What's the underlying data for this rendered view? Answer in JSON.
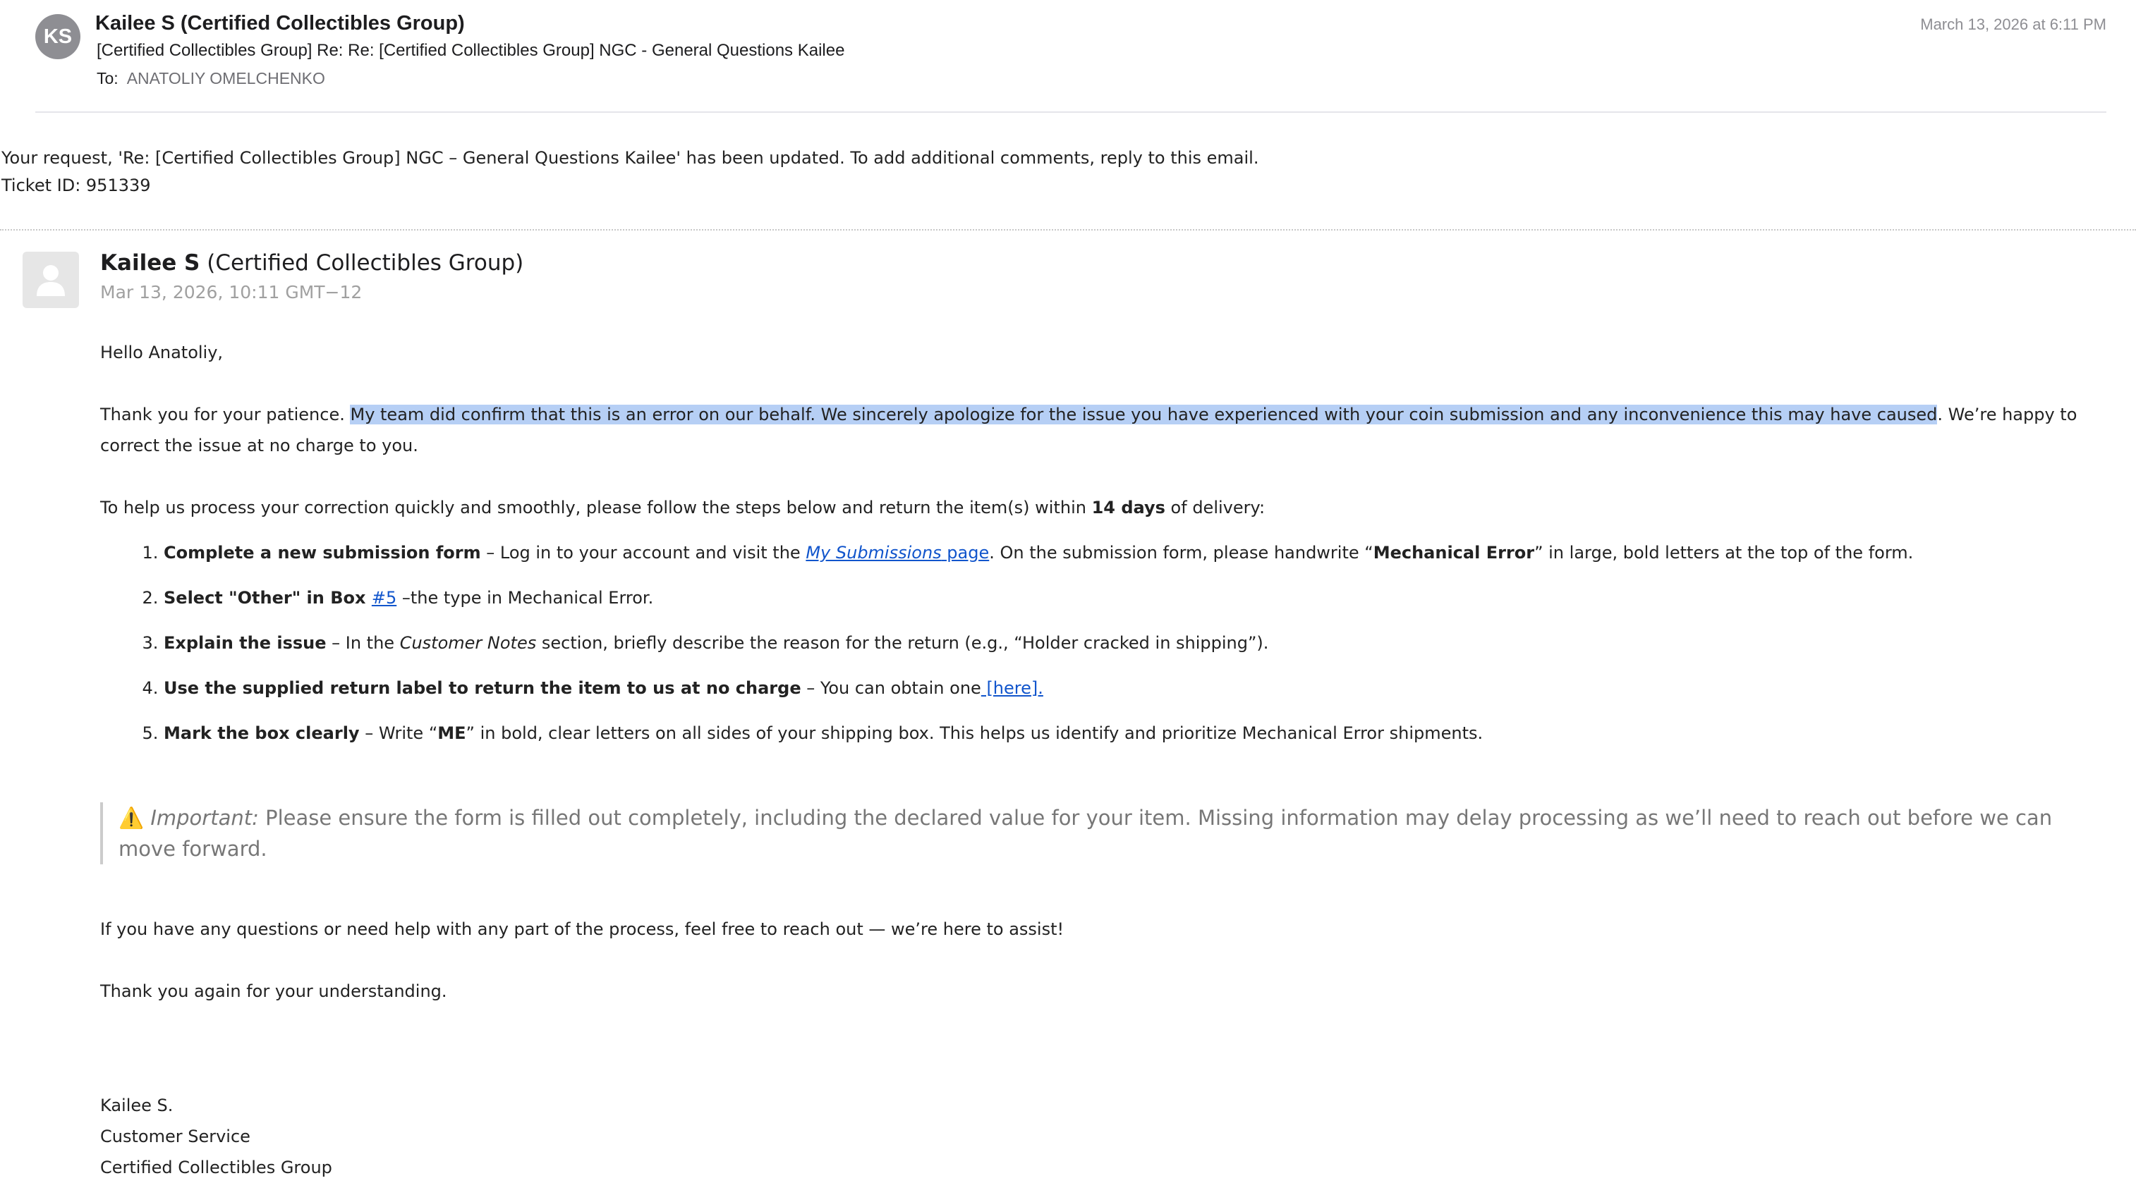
{
  "header": {
    "avatar_initials": "KS",
    "sender": "Kailee S (Certified Collectibles Group)",
    "subject": "[Certified Collectibles Group] Re: Re: [Certified Collectibles Group] NGC - General Questions Kailee",
    "to_label": "To:",
    "to_name": "ANATOLIY OMELCHENKO",
    "date": "March 13, 2026 at 6:11 PM"
  },
  "notice": {
    "line1": "Your request, 'Re: [Certified Collectibles Group] NGC – General Questions Kailee' has been updated. To add additional comments, reply to this email.",
    "line2": "Ticket ID: 951339"
  },
  "comment": {
    "author_name": "Kailee S",
    "author_org": "(Certified Collectibles Group)",
    "timestamp": "Mar 13, 2026, 10:11 GMT−12"
  },
  "message": {
    "greeting": "Hello Anatoliy,",
    "para1_start": "Thank you for your patience. ",
    "para1_highlight": "My team did confirm that this is an error on our behalf. We sincerely apologize for the issue you have experienced with your coin submission and any inconvenience this may have caused",
    "para1_end": ". We’re happy to correct the issue at no charge to you.",
    "para2_start": "To help us process your correction quickly and smoothly, please follow the steps below and return the item(s) within ",
    "para2_bold": "14 days",
    "para2_end": " of delivery:",
    "steps": [
      {
        "bold": "Complete a new submission form",
        "t1": " – Log in to your account and visit the ",
        "link_italic": "My Submissions",
        "link_rest": " page",
        "t2": ". On the submission form, please handwrite “",
        "bold2": "Mechanical Error",
        "t3": "” in large, bold letters at the top of the form."
      },
      {
        "bold": "Select \"Other\" in Box ",
        "link": "#5",
        "t1": " –the type in Mechanical Error."
      },
      {
        "bold": "Explain the issue",
        "t1": " – In the ",
        "italic": "Customer Notes",
        "t2": " section, briefly describe the reason for the return (e.g., “Holder cracked in shipping”)."
      },
      {
        "bold": "Use the supplied return label to return the item to us at no charge",
        "t1": " – You can obtain one",
        "link": " [here]."
      },
      {
        "bold": "Mark the box clearly",
        "t1": " – Write “",
        "bold2": "ME",
        "t2": "” in bold, clear letters on all sides of your shipping box. This helps us identify and prioritize Mechanical Error shipments."
      }
    ],
    "important_icon": "⚠️",
    "important_label": "Important:",
    "important_text": " Please ensure the form is filled out completely, including the declared value for your item. Missing information may delay processing as we’ll need to reach out before we can move forward.",
    "closing1": "If you have any questions or need help with any part of the process, feel free to reach out — we’re here to assist!",
    "closing2": "Thank you again for your understanding.",
    "signature": [
      "Kailee S.",
      "Customer Service",
      "Certified Collectibles Group"
    ]
  }
}
